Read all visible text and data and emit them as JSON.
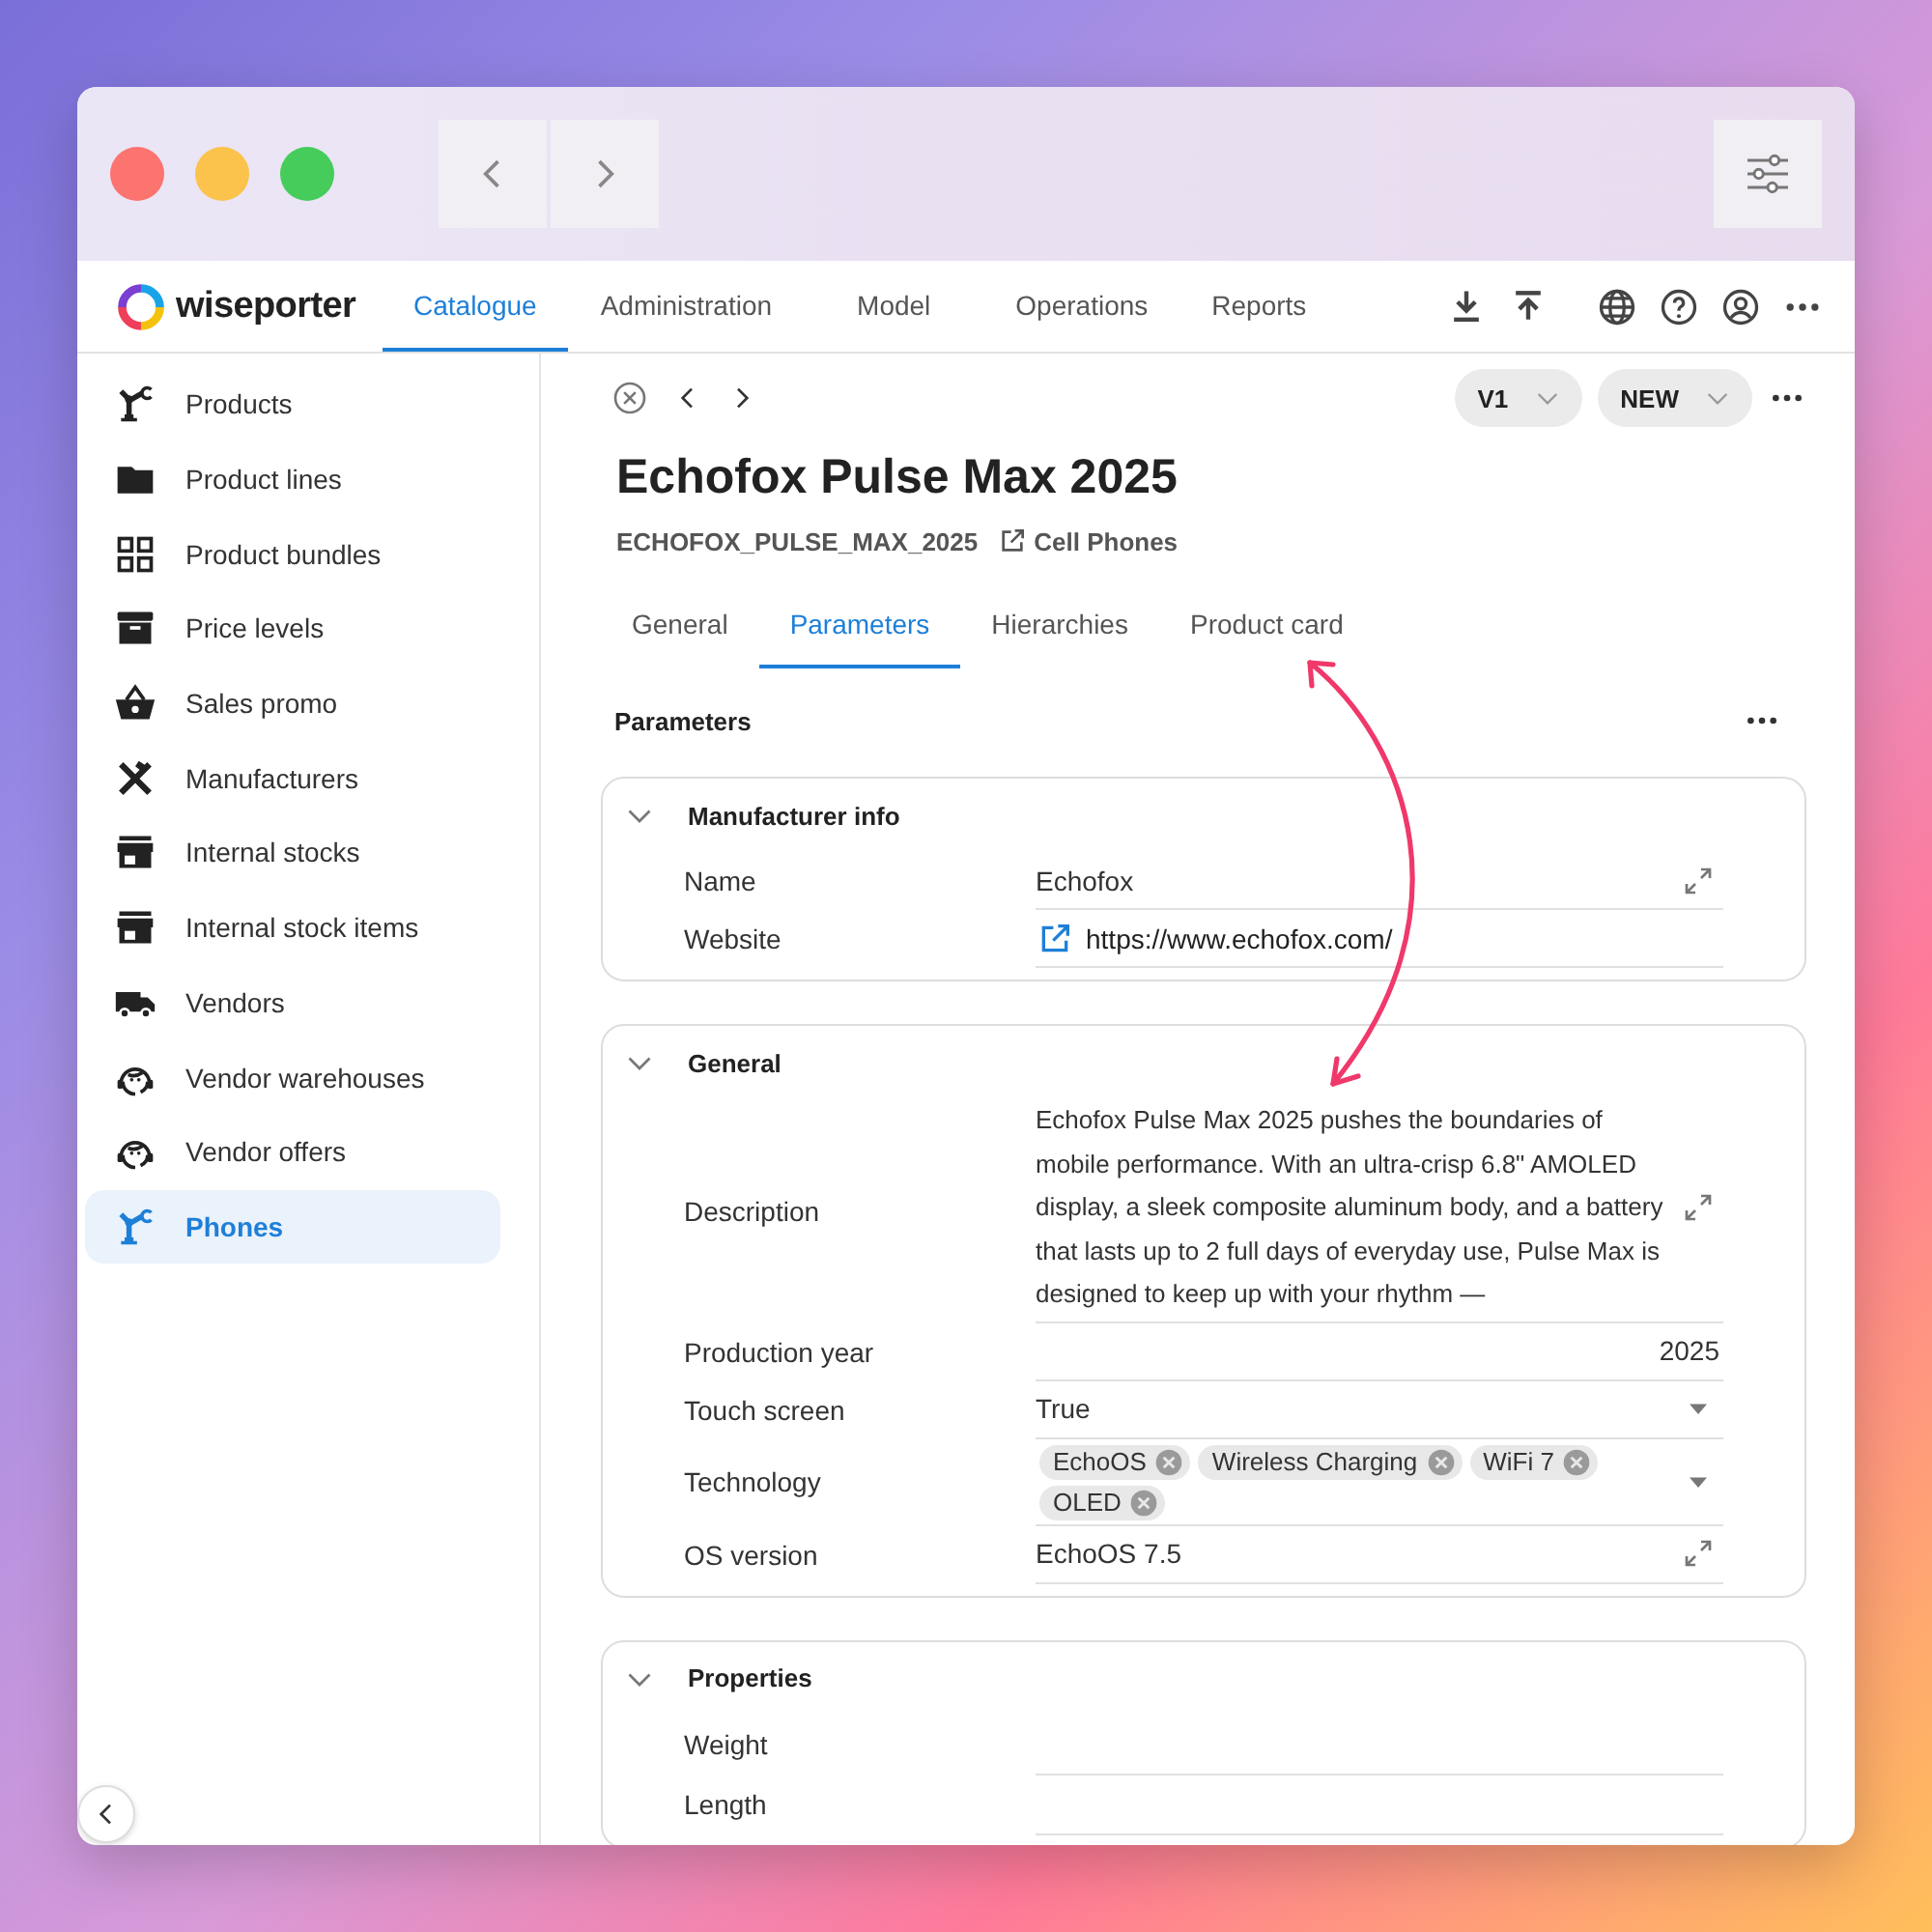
{
  "app": {
    "logo_text": "wiseporter",
    "nav_tabs": [
      {
        "label": "Catalogue",
        "selected": true
      },
      {
        "label": "Administration",
        "selected": false
      },
      {
        "label": "Model",
        "selected": false
      },
      {
        "label": "Operations",
        "selected": false
      },
      {
        "label": "Reports",
        "selected": false
      }
    ]
  },
  "sidebar": {
    "items": [
      {
        "label": "Products",
        "selected": false
      },
      {
        "label": "Product lines",
        "selected": false
      },
      {
        "label": "Product bundles",
        "selected": false
      },
      {
        "label": "Price levels",
        "selected": false
      },
      {
        "label": "Sales promo",
        "selected": false
      },
      {
        "label": "Manufacturers",
        "selected": false
      },
      {
        "label": "Internal stocks",
        "selected": false
      },
      {
        "label": "Internal stock items",
        "selected": false
      },
      {
        "label": "Vendors",
        "selected": false
      },
      {
        "label": "Vendor warehouses",
        "selected": false
      },
      {
        "label": "Vendor offers",
        "selected": false
      },
      {
        "label": "Phones",
        "selected": true
      }
    ]
  },
  "record": {
    "version": "V1",
    "status": "NEW",
    "title": "Echofox Pulse Max 2025",
    "code": "ECHOFOX_PULSE_MAX_2025",
    "category": "Cell Phones",
    "tabs": [
      {
        "label": "General",
        "selected": false
      },
      {
        "label": "Parameters",
        "selected": true
      },
      {
        "label": "Hierarchies",
        "selected": false
      },
      {
        "label": "Product card",
        "selected": false
      }
    ],
    "section_title": "Parameters",
    "groups": [
      {
        "title": "Manufacturer info",
        "expanded": true,
        "fields": [
          {
            "label": "Name",
            "kind": "text",
            "value": "Echofox"
          },
          {
            "label": "Website",
            "kind": "link",
            "value": "https://www.echofox.com/"
          }
        ]
      },
      {
        "title": "General",
        "expanded": true,
        "fields": [
          {
            "label": "Description",
            "kind": "longtext",
            "value": "Echofox Pulse Max 2025 pushes the boundaries of mobile performance. With an ultra-crisp 6.8\" AMOLED display, a sleek composite aluminum body, and a battery that lasts up to 2 full days of everyday use, Pulse Max is designed to keep up with your rhythm —"
          },
          {
            "label": "Production year",
            "kind": "number",
            "value": "2025"
          },
          {
            "label": "Touch screen",
            "kind": "select",
            "value": "True"
          },
          {
            "label": "Technology",
            "kind": "tags",
            "tags": [
              "EchoOS",
              "Wireless Charging",
              "WiFi 7",
              "OLED"
            ]
          },
          {
            "label": "OS version",
            "kind": "text",
            "value": "EchoOS 7.5"
          }
        ]
      },
      {
        "title": "Properties",
        "expanded": true,
        "fields": [
          {
            "label": "Weight",
            "kind": "empty"
          },
          {
            "label": "Length",
            "kind": "empty"
          }
        ]
      }
    ]
  }
}
